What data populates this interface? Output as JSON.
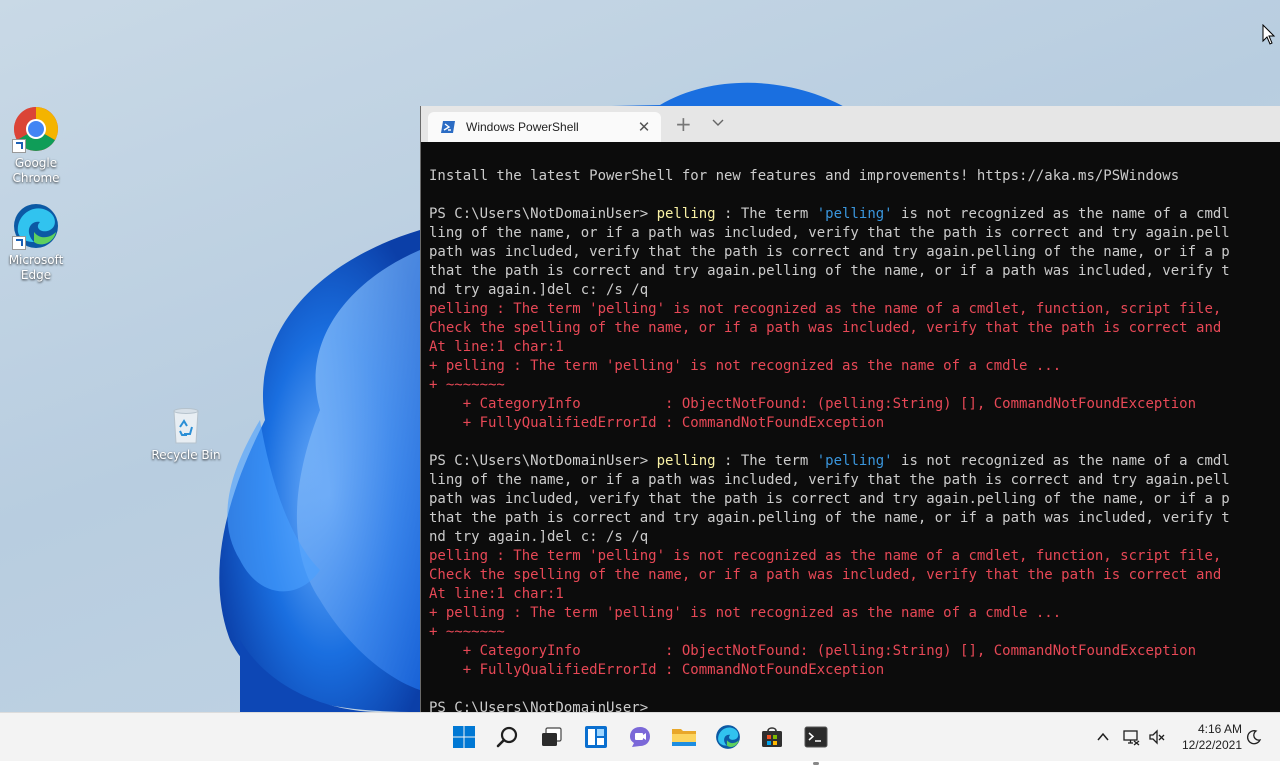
{
  "desktop": {
    "icons": [
      {
        "label_line1": "Google",
        "label_line2": "Chrome",
        "icon": "chrome-icon"
      },
      {
        "label_line1": "Microsoft",
        "label_line2": "Edge",
        "icon": "edge-icon"
      },
      {
        "label_line1": "Recycle Bin",
        "icon": "recycle-bin-icon"
      }
    ]
  },
  "terminal": {
    "tab_title": "Windows PowerShell",
    "tab_icon": "powershell-icon",
    "new_tab_label": "+",
    "close_label": "✕",
    "lines": [
      {
        "type": "plain",
        "text": ""
      },
      {
        "type": "plain",
        "text": "Install the latest PowerShell for new features and improvements! https://aka.ms/PSWindows"
      },
      {
        "type": "plain",
        "text": ""
      },
      {
        "type": "cmd",
        "prompt": "PS C:\\Users\\NotDomainUser> ",
        "command": "pelling",
        "text_a": " : The term ",
        "str": "'pelling'",
        "text_b": " is not recognized as the name of a cmdl"
      },
      {
        "type": "plain",
        "text": "ling of the name, or if a path was included, verify that the path is correct and try again.pell"
      },
      {
        "type": "plain",
        "text": "path was included, verify that the path is correct and try again.pelling of the name, or if a p"
      },
      {
        "type": "plain",
        "text": "that the path is correct and try again.pelling of the name, or if a path was included, verify t"
      },
      {
        "type": "plain",
        "text": "nd try again.]del c: /s /q"
      },
      {
        "type": "err",
        "text": "pelling : The term 'pelling' is not recognized as the name of a cmdlet, function, script file,"
      },
      {
        "type": "err",
        "text": "Check the spelling of the name, or if a path was included, verify that the path is correct and"
      },
      {
        "type": "err",
        "text": "At line:1 char:1"
      },
      {
        "type": "err",
        "text": "+ pelling : The term 'pelling' is not recognized as the name of a cmdle ..."
      },
      {
        "type": "err",
        "text": "+ ~~~~~~~"
      },
      {
        "type": "err",
        "text": "    + CategoryInfo          : ObjectNotFound: (pelling:String) [], CommandNotFoundException"
      },
      {
        "type": "err",
        "text": "    + FullyQualifiedErrorId : CommandNotFoundException"
      },
      {
        "type": "plain",
        "text": ""
      },
      {
        "type": "cmd",
        "prompt": "PS C:\\Users\\NotDomainUser> ",
        "command": "pelling",
        "text_a": " : The term ",
        "str": "'pelling'",
        "text_b": " is not recognized as the name of a cmdl"
      },
      {
        "type": "plain",
        "text": "ling of the name, or if a path was included, verify that the path is correct and try again.pell"
      },
      {
        "type": "plain",
        "text": "path was included, verify that the path is correct and try again.pelling of the name, or if a p"
      },
      {
        "type": "plain",
        "text": "that the path is correct and try again.pelling of the name, or if a path was included, verify t"
      },
      {
        "type": "plain",
        "text": "nd try again.]del c: /s /q"
      },
      {
        "type": "err",
        "text": "pelling : The term 'pelling' is not recognized as the name of a cmdlet, function, script file,"
      },
      {
        "type": "err",
        "text": "Check the spelling of the name, or if a path was included, verify that the path is correct and"
      },
      {
        "type": "err",
        "text": "At line:1 char:1"
      },
      {
        "type": "err",
        "text": "+ pelling : The term 'pelling' is not recognized as the name of a cmdle ..."
      },
      {
        "type": "err",
        "text": "+ ~~~~~~~"
      },
      {
        "type": "err",
        "text": "    + CategoryInfo          : ObjectNotFound: (pelling:String) [], CommandNotFoundException"
      },
      {
        "type": "err",
        "text": "    + FullyQualifiedErrorId : CommandNotFoundException"
      },
      {
        "type": "plain",
        "text": ""
      },
      {
        "type": "plain",
        "text": "PS C:\\Users\\NotDomainUser>"
      }
    ]
  },
  "taskbar": {
    "apps": [
      {
        "name": "start-button",
        "icon": "windows-logo-icon"
      },
      {
        "name": "search-button",
        "icon": "search-icon"
      },
      {
        "name": "task-view-button",
        "icon": "task-view-icon"
      },
      {
        "name": "widgets-button",
        "icon": "widgets-icon"
      },
      {
        "name": "chat-button",
        "icon": "teams-chat-icon"
      },
      {
        "name": "file-explorer-button",
        "icon": "folder-icon"
      },
      {
        "name": "edge-button",
        "icon": "edge-icon"
      },
      {
        "name": "store-button",
        "icon": "store-icon"
      },
      {
        "name": "terminal-button",
        "icon": "terminal-icon",
        "running": true
      }
    ],
    "tray": {
      "chevron_icon": "chevron-up-icon",
      "network_icon": "network-icon",
      "volume_icon": "volume-muted-icon",
      "focus_icon": "moon-icon"
    },
    "time": "4:16 AM",
    "date": "12/22/2021"
  },
  "colors": {
    "console_bg": "#0c0c0c",
    "console_text": "#cccccc",
    "error_text": "#e74856",
    "command_text": "#f9f1a5",
    "string_text": "#3a96dd",
    "accent": "#0078d4"
  }
}
